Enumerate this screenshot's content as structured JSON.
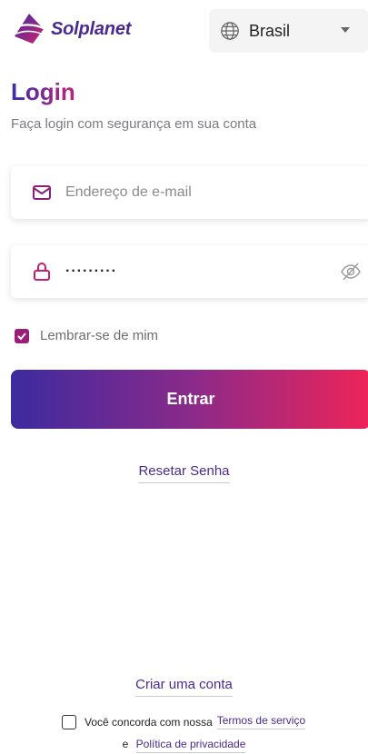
{
  "header": {
    "brand": "Solplanet",
    "region": "Brasil"
  },
  "login": {
    "title": "Login",
    "subtitle": "Faça login com segurança em sua conta",
    "email_placeholder": "Endereço de e-mail",
    "password_value": "·········",
    "remember_label": "Lembrar-se de mim",
    "remember_checked": true,
    "submit_label": "Entrar",
    "reset_label": "Resetar Senha"
  },
  "footer": {
    "create_account": "Criar uma conta",
    "agree_text": "Você concorda com nossa",
    "terms_link": "Termos de serviço",
    "and_text": "e",
    "privacy_link": "Política de privacidade"
  },
  "colors": {
    "brand_purple": "#4a2a8f",
    "accent_magenta": "#9a1f78",
    "button_gradient_start": "#3c2b9f",
    "button_gradient_end": "#ee2458"
  },
  "icons": [
    "solplanet-logo-icon",
    "globe-icon",
    "chevron-down-icon",
    "mail-icon",
    "lock-icon",
    "eye-off-icon",
    "checkbox-checked-icon",
    "checkbox-empty-icon"
  ]
}
